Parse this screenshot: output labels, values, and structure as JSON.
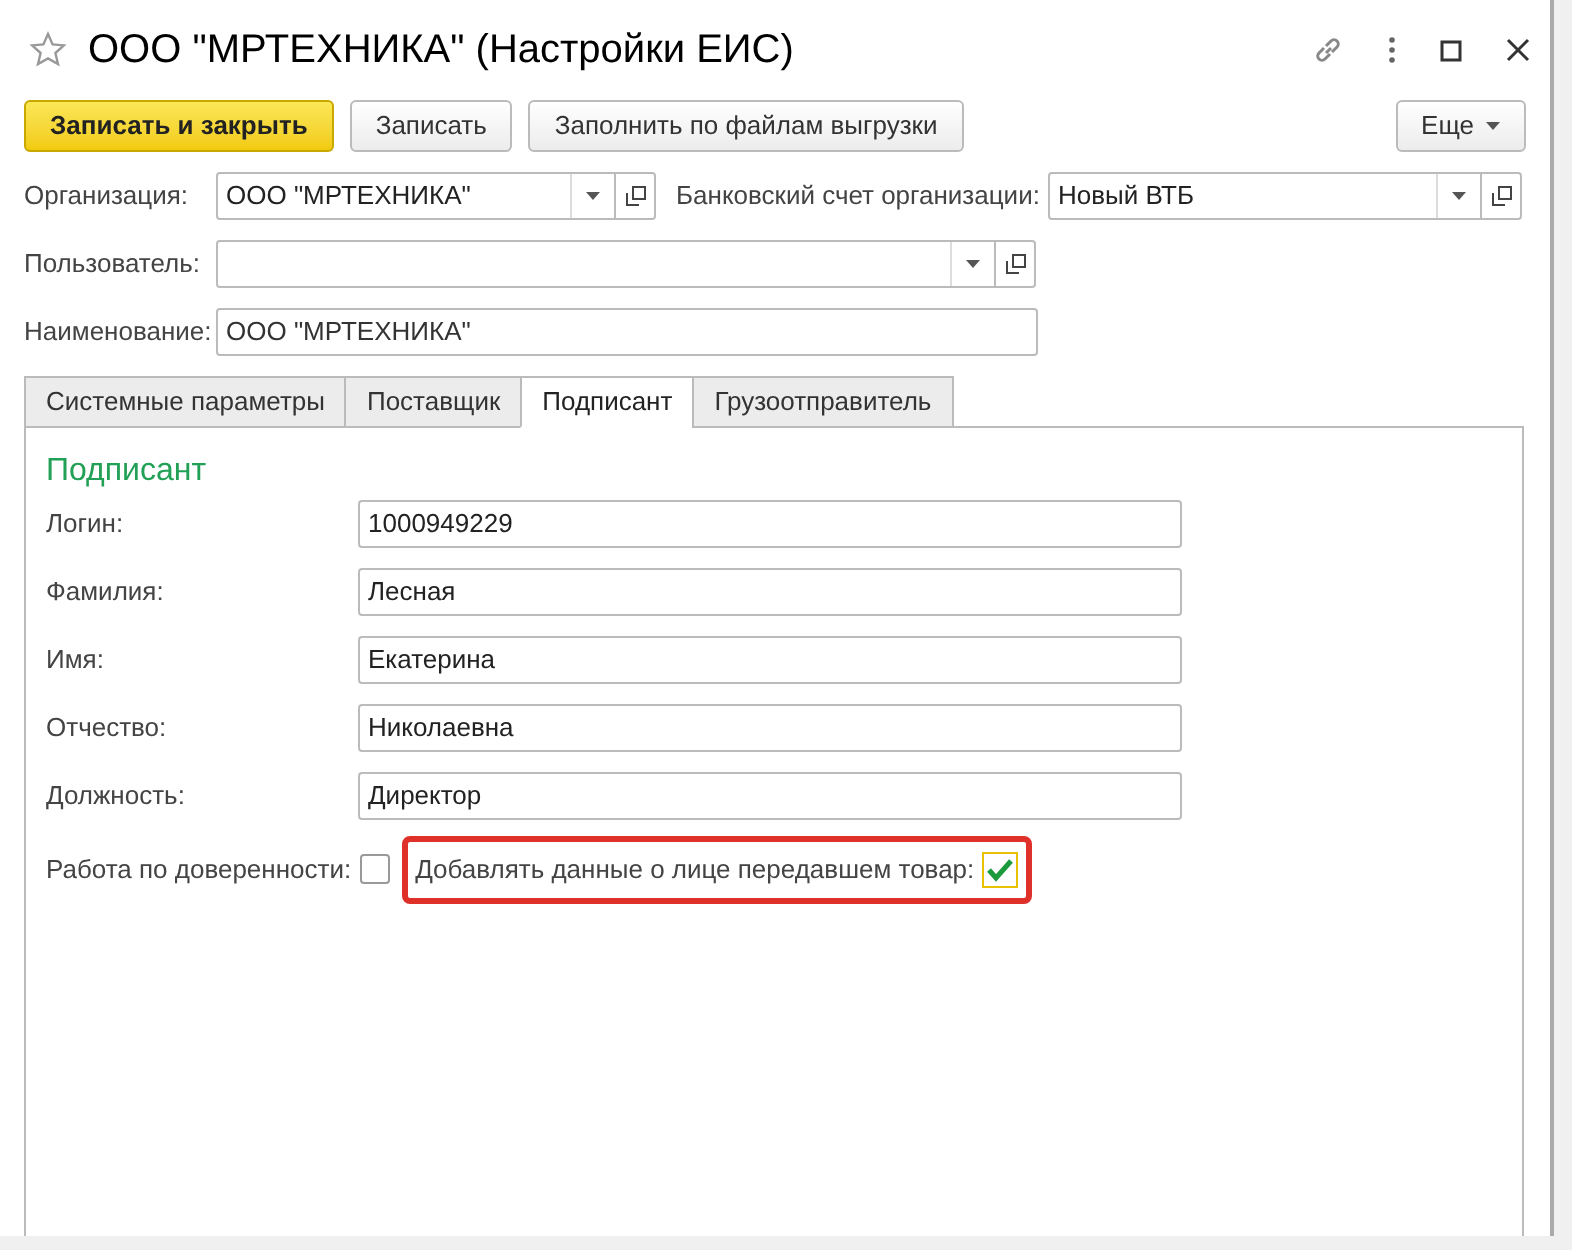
{
  "window": {
    "title": "ООО \"МРТЕХНИКА\" (Настройки ЕИС)",
    "favorite": false
  },
  "toolbar": {
    "buttons": [
      {
        "label": "Записать и закрыть",
        "kind": "primary"
      },
      {
        "label": "Записать",
        "kind": "normal"
      },
      {
        "label": "Заполнить по файлам выгрузки",
        "kind": "normal"
      }
    ],
    "more": "Еще"
  },
  "organization": {
    "label": "Организация:",
    "value": "ООО \"МРТЕХНИКА\""
  },
  "bank_account": {
    "label": "Банковский счет организации:",
    "value": "Новый ВТБ"
  },
  "user": {
    "label": "Пользователь:"
  },
  "name": {
    "label": "Наименование:",
    "value": "ООО \"МРТЕХНИКА\""
  },
  "tabs": [
    {
      "label": "Системные параметры",
      "selected": false
    },
    {
      "label": "Поставщик",
      "selected": false
    },
    {
      "label": "Подписант",
      "selected": true
    },
    {
      "label": "Грузоотправитель",
      "selected": false
    }
  ],
  "section_title": "Подписант",
  "fields": [
    {
      "label": "Логин:",
      "value": "1000949229"
    },
    {
      "label": "Фамилия:",
      "value": "Лесная"
    },
    {
      "label": "Имя:",
      "value": "Екатерина"
    },
    {
      "label": "Отчество:",
      "value": "Николаевна"
    },
    {
      "label": "Должность:",
      "value": "Директор"
    }
  ],
  "checkboxes": [
    {
      "label": "Работа по доверенности:",
      "checked": false,
      "highlighted": false
    },
    {
      "label": "Добавлять данные о лице передавшем товар:",
      "checked": true,
      "highlighted": true
    }
  ]
}
